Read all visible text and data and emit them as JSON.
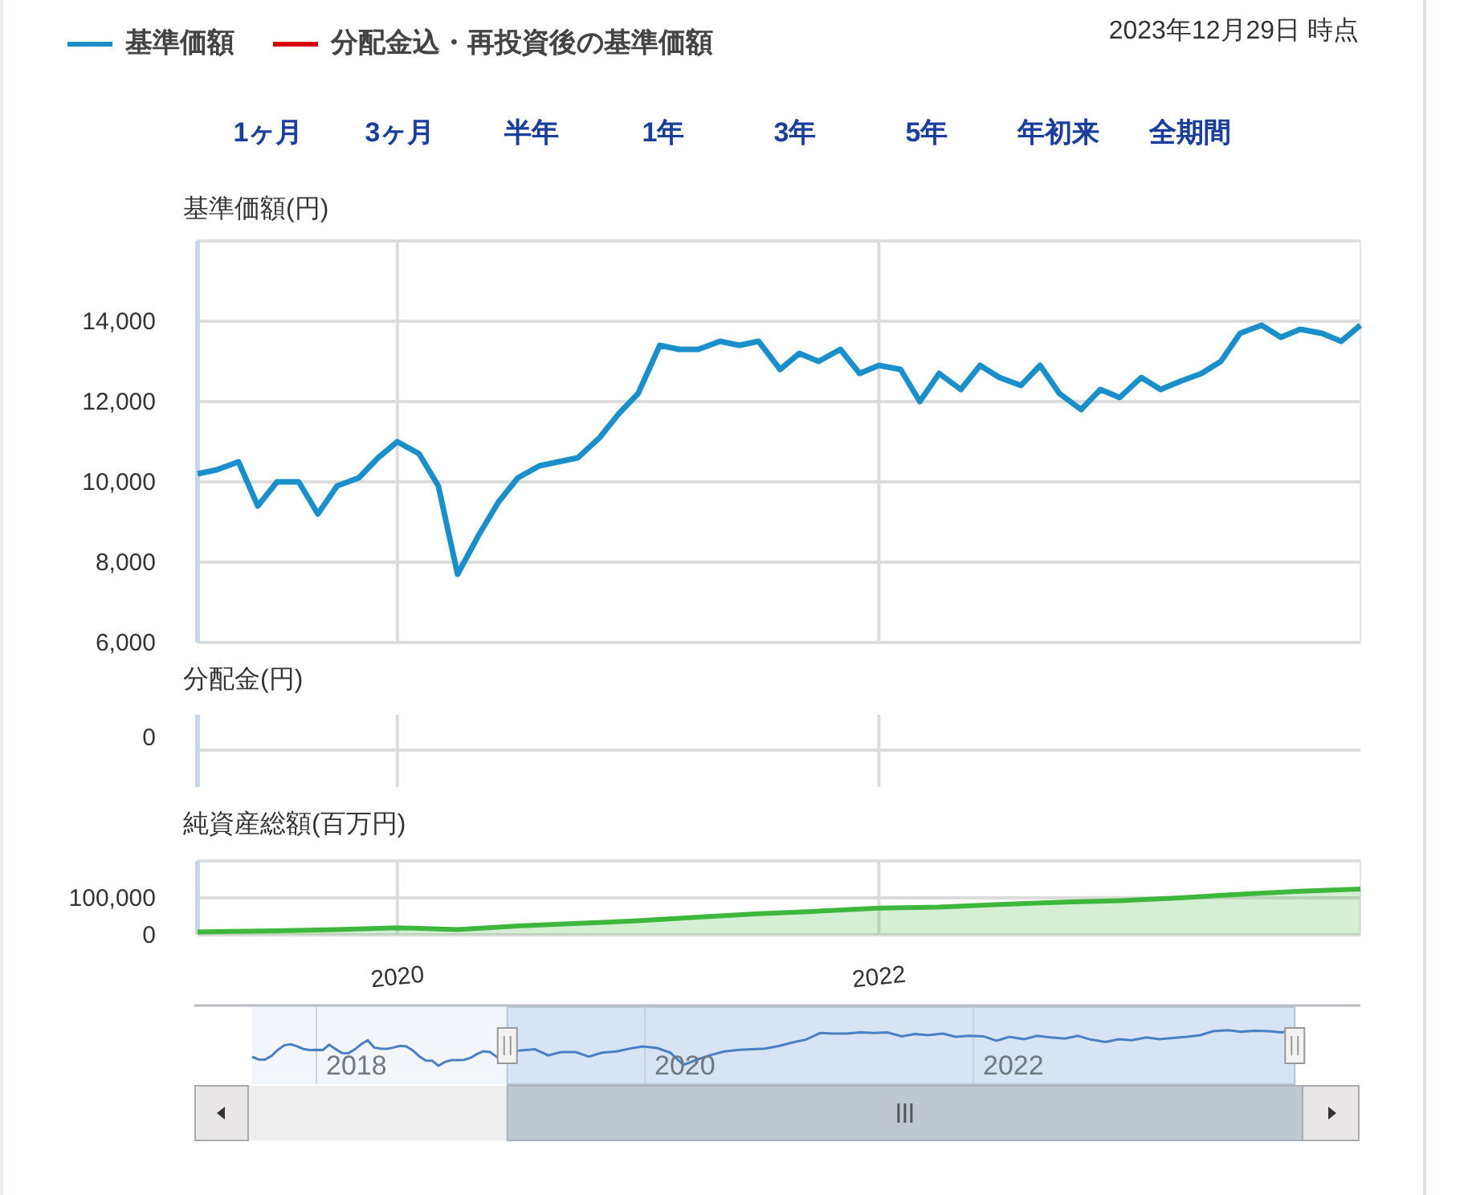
{
  "legend": [
    {
      "label": "基準価額",
      "color": "#1a8fc9"
    },
    {
      "label": "分配金込・再投資後の基準価額",
      "color": "#d7000f"
    }
  ],
  "as_of": "2023年12月29日 時点",
  "range_buttons": [
    "1ヶ月",
    "3ヶ月",
    "半年",
    "1年",
    "3年",
    "5年",
    "年初来",
    "全期間"
  ],
  "nav_panel": {
    "title": "基準価額(円)",
    "chart_data": {
      "type": "line",
      "grid": true,
      "x": [
        2019.17,
        2019.25,
        2019.34,
        2019.42,
        2019.5,
        2019.59,
        2019.67,
        2019.75,
        2019.84,
        2019.92,
        2020.0,
        2020.09,
        2020.17,
        2020.25,
        2020.34,
        2020.42,
        2020.5,
        2020.59,
        2020.67,
        2020.75,
        2020.84,
        2020.92,
        2021.0,
        2021.09,
        2021.17,
        2021.25,
        2021.34,
        2021.42,
        2021.5,
        2021.59,
        2021.67,
        2021.75,
        2021.84,
        2021.92,
        2022.0,
        2022.09,
        2022.17,
        2022.25,
        2022.34,
        2022.42,
        2022.5,
        2022.59,
        2022.67,
        2022.75,
        2022.84,
        2022.92,
        2023.0,
        2023.09,
        2023.17,
        2023.25,
        2023.34,
        2023.42,
        2023.5,
        2023.59,
        2023.67,
        2023.75,
        2023.84,
        2023.92,
        2024.0
      ],
      "series": [
        {
          "color": "#1a8fc9",
          "values": [
            10200,
            10300,
            10500,
            9400,
            10000,
            10000,
            9200,
            9900,
            10100,
            10600,
            11000,
            10700,
            9900,
            7700,
            8700,
            9500,
            10100,
            10400,
            10500,
            10600,
            11100,
            11700,
            12200,
            13400,
            13300,
            13300,
            13500,
            13400,
            13500,
            12800,
            13200,
            13000,
            13300,
            12700,
            12900,
            12800,
            12000,
            12700,
            12300,
            12900,
            12600,
            12400,
            12900,
            12200,
            11800,
            12300,
            12100,
            12600,
            12300,
            12500,
            12700,
            13000,
            13700,
            13900,
            13600,
            13800,
            13700,
            13500,
            13900
          ]
        }
      ],
      "xlim": [
        2019.17,
        2024.0
      ],
      "ylim": [
        6000,
        16000
      ],
      "yticks": [
        {
          "value": 6000,
          "label": "6,000"
        },
        {
          "value": 8000,
          "label": "8,000"
        },
        {
          "value": 10000,
          "label": "10,000"
        },
        {
          "value": 12000,
          "label": "12,000"
        },
        {
          "value": 14000,
          "label": "14,000"
        }
      ]
    }
  },
  "dividend_panel": {
    "title": "分配金(円)",
    "y_tick": "0"
  },
  "assets_panel": {
    "title": "純資産総額(百万円)",
    "chart_data": {
      "type": "area",
      "grid": true,
      "x": [
        2019.17,
        2019.5,
        2019.75,
        2020.0,
        2020.25,
        2020.5,
        2020.75,
        2021.0,
        2021.25,
        2021.5,
        2021.75,
        2022.0,
        2022.25,
        2022.5,
        2022.75,
        2023.0,
        2023.25,
        2023.5,
        2023.75,
        2024.0
      ],
      "series": [
        {
          "color": "#3db83d",
          "values": [
            8000,
            11000,
            14000,
            19000,
            14000,
            24000,
            31000,
            38000,
            48000,
            57000,
            64000,
            72000,
            75000,
            82000,
            88000,
            92000,
            100000,
            110000,
            118000,
            124000
          ]
        }
      ],
      "xlim": [
        2019.17,
        2024.0
      ],
      "ylim": [
        0,
        200000
      ],
      "xticks": [
        {
          "value": 2020,
          "label": "2020"
        },
        {
          "value": 2022,
          "label": "2022"
        }
      ],
      "yticks": [
        {
          "value": 0,
          "label": "0"
        },
        {
          "value": 100000,
          "label": "100,000"
        }
      ]
    }
  },
  "navigator": {
    "labels": [
      "2018",
      "2020",
      "2022"
    ]
  }
}
